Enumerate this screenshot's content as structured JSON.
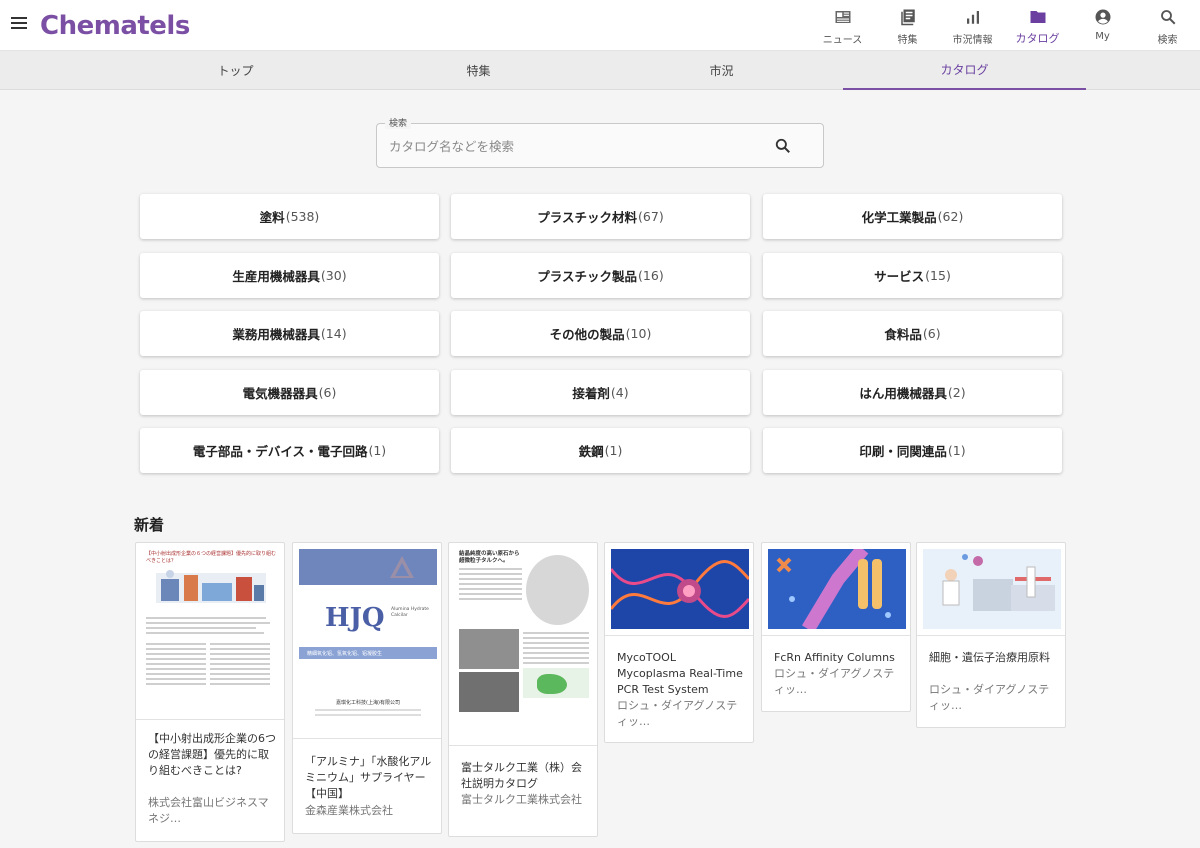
{
  "header": {
    "logo": "Chematels",
    "nav": [
      {
        "label": "ニュース",
        "icon": "news-icon"
      },
      {
        "label": "特集",
        "icon": "feature-icon"
      },
      {
        "label": "市況情報",
        "icon": "market-chart-icon"
      },
      {
        "label": "カタログ",
        "icon": "folder-icon",
        "active": true
      },
      {
        "label": "My",
        "icon": "account-icon"
      },
      {
        "label": "検索",
        "icon": "search-icon"
      }
    ]
  },
  "tabs": [
    {
      "label": "トップ"
    },
    {
      "label": "特集"
    },
    {
      "label": "市況"
    },
    {
      "label": "カタログ",
      "active": true
    }
  ],
  "search": {
    "legend": "検索",
    "placeholder": "カタログ名などを検索",
    "value": ""
  },
  "categories": [
    {
      "name": "塗料",
      "count": "(538)"
    },
    {
      "name": "プラスチック材料",
      "count": "(67)"
    },
    {
      "name": "化学工業製品",
      "count": "(62)"
    },
    {
      "name": "生産用機械器具",
      "count": "(30)"
    },
    {
      "name": "プラスチック製品",
      "count": "(16)"
    },
    {
      "name": "サービス",
      "count": "(15)"
    },
    {
      "name": "業務用機械器具",
      "count": "(14)"
    },
    {
      "name": "その他の製品",
      "count": "(10)"
    },
    {
      "name": "食料品",
      "count": "(6)"
    },
    {
      "name": "電気機器器具",
      "count": "(6)"
    },
    {
      "name": "接着剤",
      "count": "(4)"
    },
    {
      "name": "はん用機械器具",
      "count": "(2)"
    },
    {
      "name": "電子部品・デバイス・電子回路",
      "count": "(1)"
    },
    {
      "name": "鉄鋼",
      "count": "(1)"
    },
    {
      "name": "印刷・同関連品",
      "count": "(1)"
    }
  ],
  "new_section": {
    "title": "新着",
    "cards": [
      {
        "title": "【中小射出成形企業の6つの経営課題】優先的に取り組むべきことは?",
        "company": "株式会社富山ビジネスマネジ…",
        "thumb_heading": "【中小射出成形企業の６つの経営課題】優先的に取り組むべきことは？"
      },
      {
        "title": "「アルミナ」「水酸化アルミニウム」サプライヤー【中国】",
        "company": "金森産業株式会社",
        "thumb_brand": "HJQ",
        "thumb_sub": "Alumina Hydrate Calcilar",
        "thumb_band": "精細氧化铝、氢氧化铝、铝凝胶生",
        "thumb_footer": "嘉琪化工科技(上海)有限公司"
      },
      {
        "title": "富士タルク工業（株）会社説明カタログ",
        "company": "富士タルク工業株式会社",
        "thumb_heading": "結晶純度の高い原石から超微粒子タルクへ。"
      },
      {
        "title": "MycoTOOL Mycoplasma Real-Time PCR Test System",
        "company": "ロシュ・ダイアグノスティッ…"
      },
      {
        "title": "FcRn Affinity Columns",
        "company": "ロシュ・ダイアグノスティッ…"
      },
      {
        "title": "細胞・遺伝子治療用原料",
        "company": "ロシュ・ダイアグノスティッ…"
      }
    ]
  },
  "colors": {
    "brand": "#7b4fa3",
    "active": "#6a3fa0",
    "background": "#f5f5f5"
  }
}
